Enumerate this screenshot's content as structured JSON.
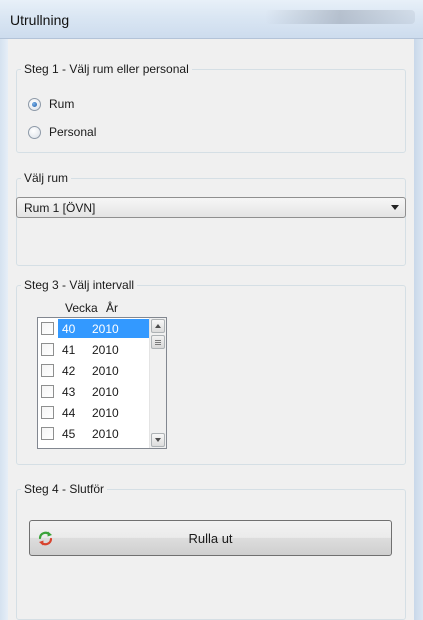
{
  "window": {
    "title": "Utrullning"
  },
  "step1": {
    "legend": "Steg 1 - Välj rum eller personal",
    "options": [
      {
        "label": "Rum",
        "selected": true
      },
      {
        "label": "Personal",
        "selected": false
      }
    ]
  },
  "step2": {
    "legend": "Välj rum",
    "selected_room": "Rum 1  [ÖVN]"
  },
  "step3": {
    "legend": "Steg 3 - Välj intervall",
    "columns": {
      "week": "Vecka",
      "year": "År"
    },
    "rows": [
      {
        "week": "40",
        "year": "2010",
        "checked": false,
        "selected": true
      },
      {
        "week": "41",
        "year": "2010",
        "checked": false,
        "selected": false
      },
      {
        "week": "42",
        "year": "2010",
        "checked": false,
        "selected": false
      },
      {
        "week": "43",
        "year": "2010",
        "checked": false,
        "selected": false
      },
      {
        "week": "44",
        "year": "2010",
        "checked": false,
        "selected": false
      },
      {
        "week": "45",
        "year": "2010",
        "checked": false,
        "selected": false
      }
    ]
  },
  "step4": {
    "legend": "Steg 4 - Slutför",
    "button_label": "Rulla ut"
  },
  "icons": {
    "rollout": "refresh-arrows-icon",
    "dropdown": "chevron-down-icon",
    "scroll_up": "scroll-up-icon",
    "scroll_down": "scroll-down-icon"
  },
  "colors": {
    "selection": "#3399ff",
    "window_chrome": "#dae6f3"
  }
}
